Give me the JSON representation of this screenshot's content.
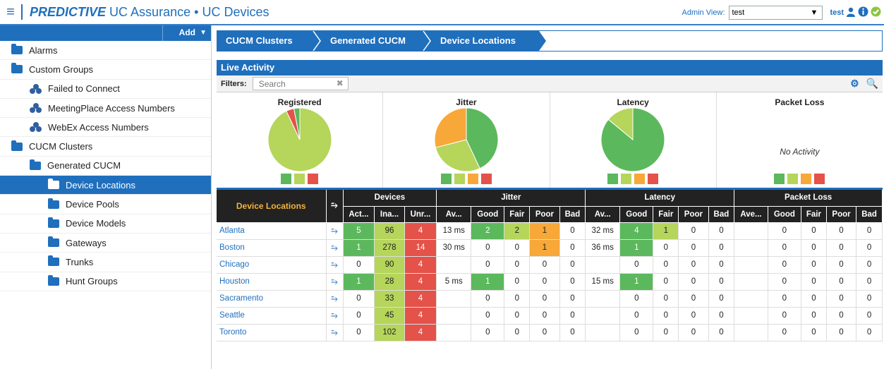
{
  "header": {
    "brand_bold": "PREDICTIVE",
    "brand_rest": "UC Assurance",
    "dot": "•",
    "page": "UC Devices",
    "admin_view_label": "Admin View:",
    "admin_view_value": "test",
    "user": "test",
    "icons": [
      "menu-icon",
      "user-icon",
      "info-icon",
      "check-icon"
    ]
  },
  "sidebar": {
    "add_label": "Add",
    "items": [
      {
        "label": "Alarms",
        "icon": "folder-icon",
        "level": 0
      },
      {
        "label": "Custom Groups",
        "icon": "folder-icon",
        "level": 0
      },
      {
        "label": "Failed to Connect",
        "icon": "group-icon",
        "level": 1
      },
      {
        "label": "MeetingPlace Access Numbers",
        "icon": "group-icon",
        "level": 1
      },
      {
        "label": "WebEx Access Numbers",
        "icon": "group-icon",
        "level": 1
      },
      {
        "label": "CUCM Clusters",
        "icon": "folder-icon",
        "level": 0
      },
      {
        "label": "Generated CUCM",
        "icon": "folder-icon",
        "level": 1
      },
      {
        "label": "Device Locations",
        "icon": "folder-icon",
        "level": 2,
        "selected": true
      },
      {
        "label": "Device Pools",
        "icon": "folder-icon",
        "level": 2
      },
      {
        "label": "Device Models",
        "icon": "folder-icon",
        "level": 2
      },
      {
        "label": "Gateways",
        "icon": "folder-icon",
        "level": 2
      },
      {
        "label": "Trunks",
        "icon": "folder-icon",
        "level": 2
      },
      {
        "label": "Hunt Groups",
        "icon": "folder-icon",
        "level": 2
      }
    ]
  },
  "breadcrumb": [
    "CUCM Clusters",
    "Generated CUCM",
    "Device Locations"
  ],
  "live": {
    "title": "Live Activity",
    "filters_label": "Filters:",
    "search_placeholder": "Search",
    "colors": {
      "green": "#5cb85c",
      "lightgreen": "#b5d55b",
      "orange": "#f7a839",
      "red": "#e4524a"
    }
  },
  "charts": [
    {
      "title": "Registered",
      "slices": [
        {
          "value": 93,
          "color": "#b5d55b"
        },
        {
          "value": 4,
          "color": "#e4524a"
        },
        {
          "value": 3,
          "color": "#5cb85c"
        }
      ],
      "legend": [
        "#5cb85c",
        "#b5d55b",
        "#e4524a"
      ]
    },
    {
      "title": "Jitter",
      "slices": [
        {
          "value": 43,
          "color": "#5cb85c"
        },
        {
          "value": 28,
          "color": "#b5d55b"
        },
        {
          "value": 29,
          "color": "#f7a839"
        }
      ],
      "legend": [
        "#5cb85c",
        "#b5d55b",
        "#f7a839",
        "#e4524a"
      ]
    },
    {
      "title": "Latency",
      "slices": [
        {
          "value": 86,
          "color": "#5cb85c"
        },
        {
          "value": 14,
          "color": "#b5d55b"
        }
      ],
      "legend": [
        "#5cb85c",
        "#b5d55b",
        "#f7a839",
        "#e4524a"
      ]
    },
    {
      "title": "Packet Loss",
      "no_activity": "No Activity",
      "slices": [],
      "legend": [
        "#5cb85c",
        "#b5d55b",
        "#f7a839",
        "#e4524a"
      ]
    }
  ],
  "table": {
    "loc_header": "Device Locations",
    "group_headers": [
      "Devices",
      "Jitter",
      "Latency",
      "Packet Loss"
    ],
    "sub_headers": [
      "Act...",
      "Ina...",
      "Unr...",
      "Av...",
      "Good",
      "Fair",
      "Poor",
      "Bad",
      "Av...",
      "Good",
      "Fair",
      "Poor",
      "Bad",
      "Ave...",
      "Good",
      "Fair",
      "Poor",
      "Bad"
    ],
    "rows": [
      {
        "name": "Atlanta",
        "cells": [
          "5",
          "96",
          "4",
          "13 ms",
          "2",
          "2",
          "1",
          "0",
          "32 ms",
          "4",
          "1",
          "0",
          "0",
          "",
          "0",
          "0",
          "0",
          "0"
        ],
        "styles": [
          "g",
          "lg",
          "r",
          "",
          "g",
          "lg",
          "o",
          "",
          "",
          "g",
          "lg",
          "",
          "",
          "",
          "",
          "",
          "",
          ""
        ]
      },
      {
        "name": "Boston",
        "cells": [
          "1",
          "278",
          "14",
          "30 ms",
          "0",
          "0",
          "1",
          "0",
          "36 ms",
          "1",
          "0",
          "0",
          "0",
          "",
          "0",
          "0",
          "0",
          "0"
        ],
        "styles": [
          "g",
          "lg",
          "r",
          "",
          "",
          "",
          "o",
          "",
          "",
          "g",
          "",
          "",
          "",
          "",
          "",
          "",
          "",
          ""
        ]
      },
      {
        "name": "Chicago",
        "cells": [
          "0",
          "90",
          "4",
          "",
          "0",
          "0",
          "0",
          "0",
          "",
          "0",
          "0",
          "0",
          "0",
          "",
          "0",
          "0",
          "0",
          "0"
        ],
        "styles": [
          "",
          "lg",
          "r",
          "",
          "",
          "",
          "",
          "",
          "",
          "",
          "",
          "",
          "",
          "",
          "",
          "",
          "",
          ""
        ]
      },
      {
        "name": "Houston",
        "cells": [
          "1",
          "28",
          "4",
          "5 ms",
          "1",
          "0",
          "0",
          "0",
          "15 ms",
          "1",
          "0",
          "0",
          "0",
          "",
          "0",
          "0",
          "0",
          "0"
        ],
        "styles": [
          "g",
          "lg",
          "r",
          "",
          "g",
          "",
          "",
          "",
          "",
          "g",
          "",
          "",
          "",
          "",
          "",
          "",
          "",
          ""
        ]
      },
      {
        "name": "Sacramento",
        "cells": [
          "0",
          "33",
          "4",
          "",
          "0",
          "0",
          "0",
          "0",
          "",
          "0",
          "0",
          "0",
          "0",
          "",
          "0",
          "0",
          "0",
          "0"
        ],
        "styles": [
          "",
          "lg",
          "r",
          "",
          "",
          "",
          "",
          "",
          "",
          "",
          "",
          "",
          "",
          "",
          "",
          "",
          "",
          ""
        ]
      },
      {
        "name": "Seattle",
        "cells": [
          "0",
          "45",
          "4",
          "",
          "0",
          "0",
          "0",
          "0",
          "",
          "0",
          "0",
          "0",
          "0",
          "",
          "0",
          "0",
          "0",
          "0"
        ],
        "styles": [
          "",
          "lg",
          "r",
          "",
          "",
          "",
          "",
          "",
          "",
          "",
          "",
          "",
          "",
          "",
          "",
          "",
          "",
          ""
        ]
      },
      {
        "name": "Toronto",
        "cells": [
          "0",
          "102",
          "4",
          "",
          "0",
          "0",
          "0",
          "0",
          "",
          "0",
          "0",
          "0",
          "0",
          "",
          "0",
          "0",
          "0",
          "0"
        ],
        "styles": [
          "",
          "lg",
          "r",
          "",
          "",
          "",
          "",
          "",
          "",
          "",
          "",
          "",
          "",
          "",
          "",
          "",
          "",
          ""
        ]
      }
    ]
  }
}
